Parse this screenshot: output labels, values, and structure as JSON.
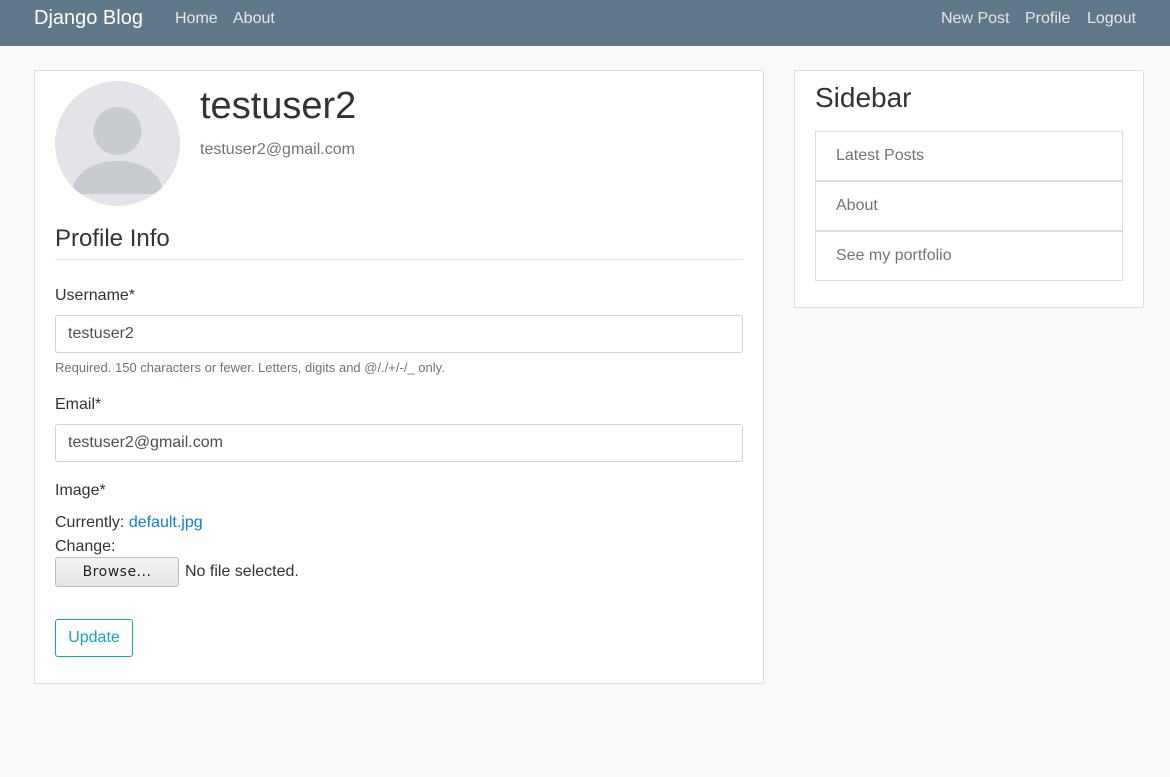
{
  "navbar": {
    "brand": "Django Blog",
    "left_links": [
      "Home",
      "About"
    ],
    "right_links": [
      "New Post",
      "Profile",
      "Logout"
    ],
    "bg_color": "#5f788a"
  },
  "profile": {
    "avatar_icon": "default-user-avatar-icon",
    "username": "testuser2",
    "email": "testuser2@gmail.com"
  },
  "form": {
    "legend": "Profile Info",
    "username_label": "Username*",
    "username_value": "testuser2",
    "username_help": "Required. 150 characters or fewer. Letters, digits and @/./+/-/_ only.",
    "email_label": "Email*",
    "email_value": "testuser2@gmail.com",
    "image_label": "Image*",
    "currently_label": "Currently:",
    "currently_file": "default.jpg",
    "change_label": "Change:",
    "browse_label": "Browse...",
    "no_file_text": "No file selected.",
    "submit_label": "Update",
    "submit_color": "#17a2b8"
  },
  "sidebar": {
    "title": "Sidebar",
    "items": [
      "Latest Posts",
      "About",
      "See my portfolio"
    ]
  }
}
